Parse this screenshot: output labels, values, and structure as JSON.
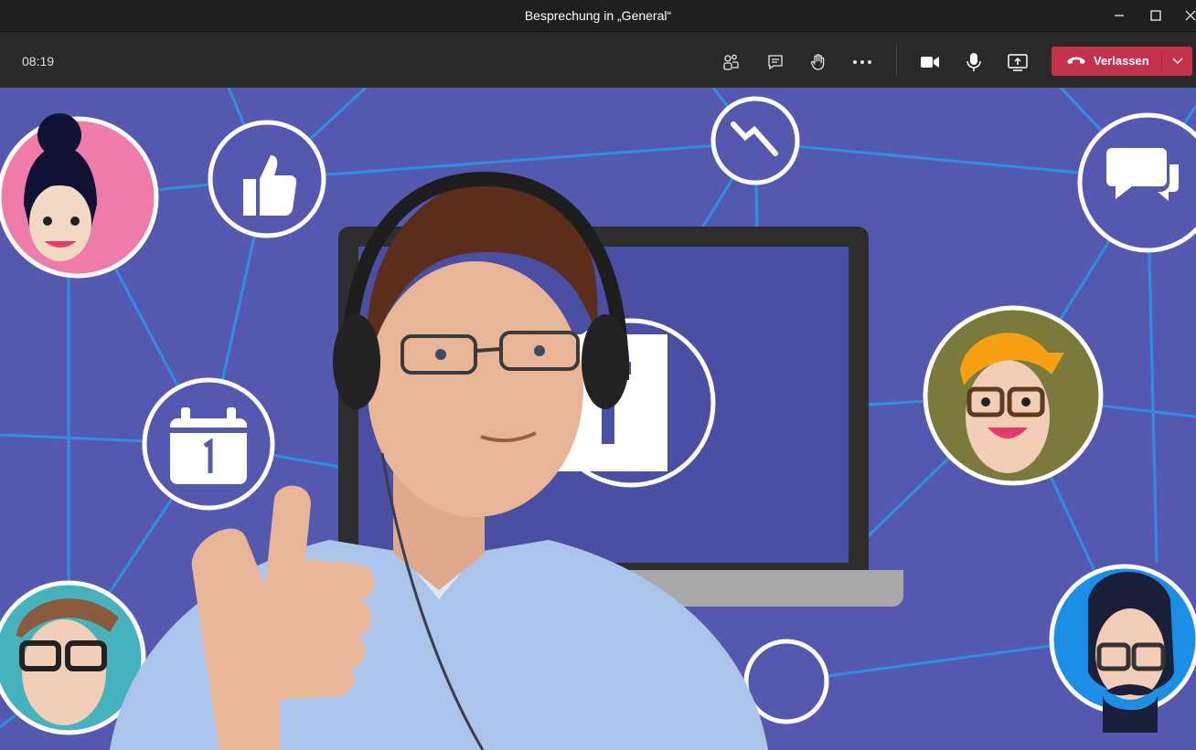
{
  "window": {
    "title": "Besprechung in „General“",
    "controls": [
      "minimize-icon",
      "maximize-icon",
      "close-icon"
    ]
  },
  "toolbar": {
    "timer": "08:19",
    "buttons": [
      "participants-icon",
      "chat-icon",
      "raise-hand-icon",
      "more-options-icon",
      "camera-icon",
      "microphone-icon",
      "share-screen-icon"
    ],
    "leave_label": "Verlassen"
  },
  "colors": {
    "titlebar": "#1f1f1f",
    "toolbar": "#292929",
    "leave": "#c4314b",
    "background": "#5558af",
    "network_lines": "#2f8ee0"
  },
  "scene": {
    "icons": [
      "thumbs-up-icon",
      "trend-down-icon",
      "speech-bubbles-icon",
      "calendar-icon",
      "teams-logo-icon"
    ],
    "avatars": [
      "avatar-woman",
      "avatar-orange-hair",
      "avatar-glasses",
      "avatar-beard"
    ],
    "participant": "participant-video"
  }
}
